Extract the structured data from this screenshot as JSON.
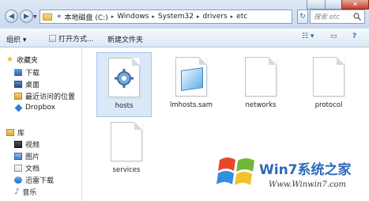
{
  "window": {
    "close_label": "✕"
  },
  "address": {
    "crumbs": [
      "«",
      "本地磁盘 (C:)",
      "Windows",
      "System32",
      "drivers",
      "etc"
    ],
    "separator": "▸"
  },
  "search": {
    "placeholder": "搜索 etc"
  },
  "toolbar": {
    "organize": "组织 ▾",
    "open": "打开方式...",
    "new_folder": "新建文件夹"
  },
  "sidebar": {
    "favorites": "收藏夹",
    "items": [
      "下载",
      "桌面",
      "最近访问的位置",
      "Dropbox"
    ],
    "library": "库",
    "lib_items": [
      "视频",
      "图片",
      "文档",
      "迅雷下载",
      "音乐"
    ]
  },
  "files": [
    {
      "name": "hosts",
      "selected": true,
      "icon": "settings-file-icon"
    },
    {
      "name": "lmhosts.sam",
      "selected": false,
      "icon": "notepad-file-icon"
    },
    {
      "name": "networks",
      "selected": false,
      "icon": "blank-file-icon"
    },
    {
      "name": "protocol",
      "selected": false,
      "icon": "blank-file-icon"
    },
    {
      "name": "services",
      "selected": false,
      "icon": "blank-file-icon"
    }
  ],
  "watermark": {
    "brand": "Win7系统之家",
    "url": "Www.Winwin7.com"
  },
  "colors": {
    "accent": "#2f6fbf",
    "selection": "#dbe8f8"
  }
}
